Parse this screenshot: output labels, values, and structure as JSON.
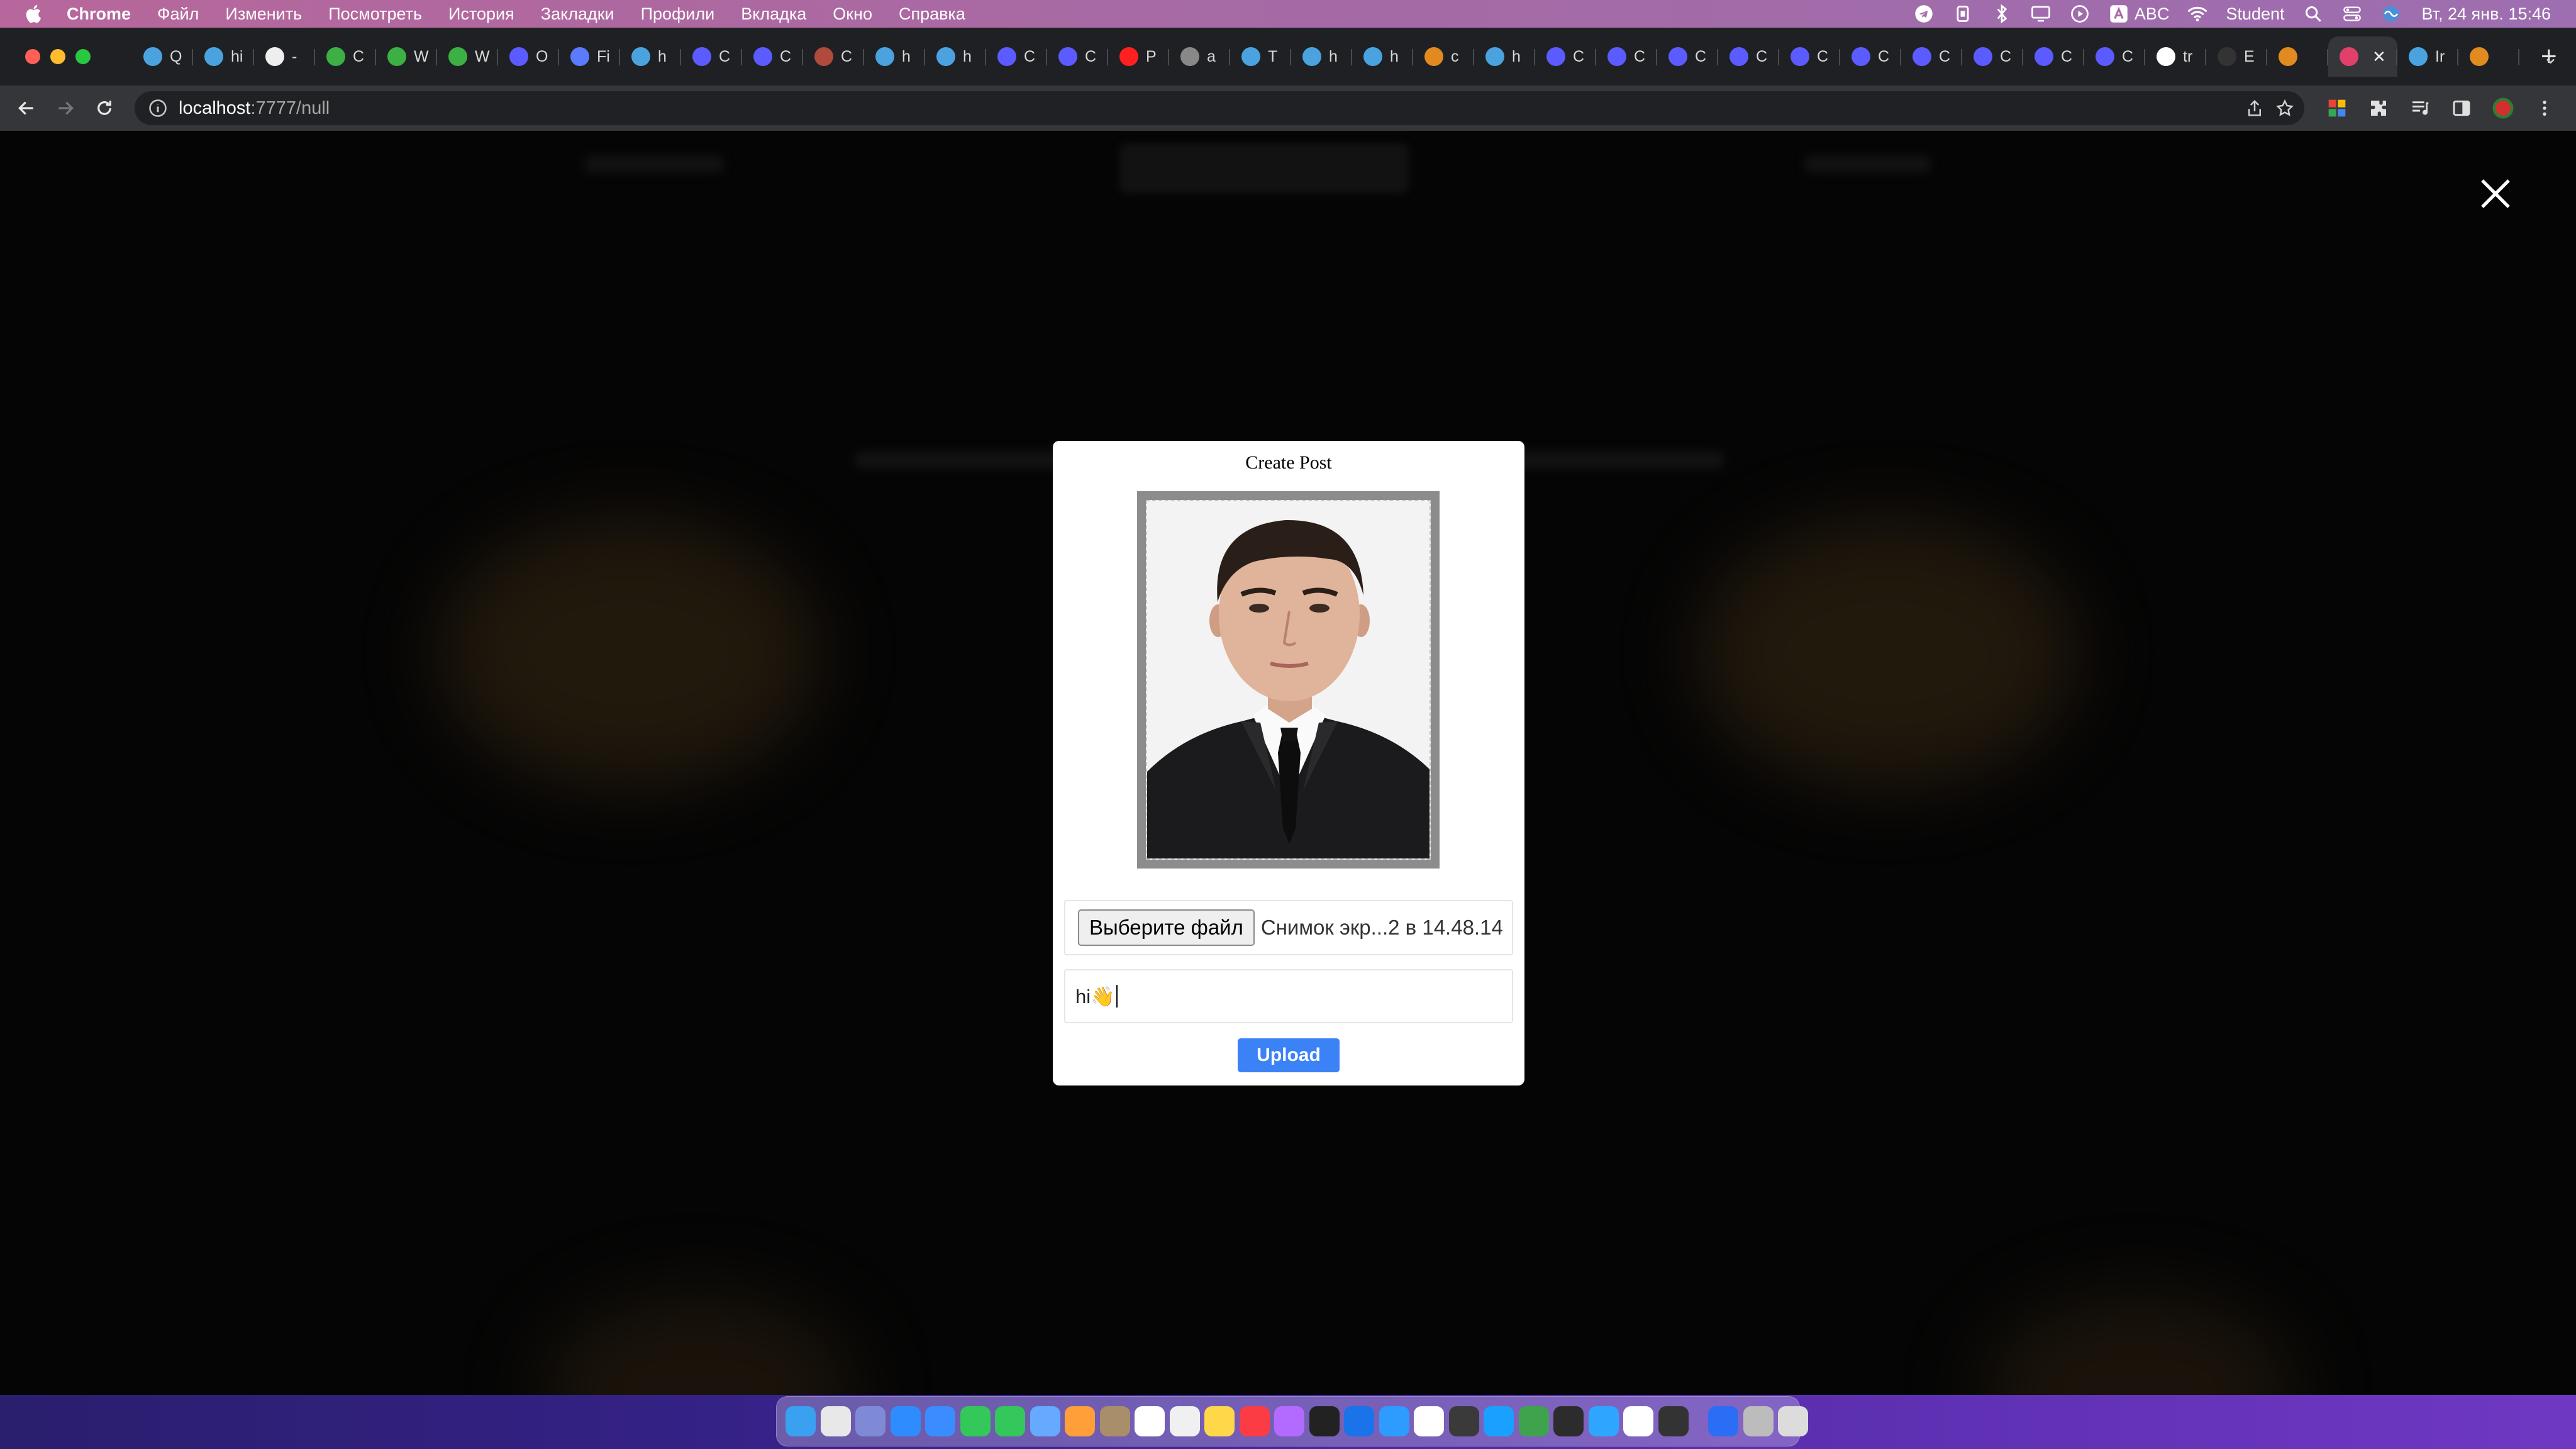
{
  "menubar": {
    "app_name": "Chrome",
    "items": [
      "Файл",
      "Изменить",
      "Посмотреть",
      "История",
      "Закладки",
      "Профили",
      "Вкладка",
      "Окно",
      "Справка"
    ],
    "input_source": "ABC",
    "user": "Student",
    "clock": "Вт, 24 янв.  15:46"
  },
  "tabs": [
    {
      "label": "Q",
      "color": "#4aa3df"
    },
    {
      "label": "hi",
      "color": "#4aa3df"
    },
    {
      "label": "-",
      "color": "#eeeeee"
    },
    {
      "label": "C",
      "color": "#3cb043"
    },
    {
      "label": "W",
      "color": "#3cb043"
    },
    {
      "label": "W",
      "color": "#3cb043"
    },
    {
      "label": "O",
      "color": "#5b5bff"
    },
    {
      "label": "Fi",
      "color": "#5b7bff"
    },
    {
      "label": "h",
      "color": "#4aa3df"
    },
    {
      "label": "C",
      "color": "#5b5bff"
    },
    {
      "label": "C",
      "color": "#5b5bff"
    },
    {
      "label": "C",
      "color": "#b04a3c"
    },
    {
      "label": "h",
      "color": "#4aa3df"
    },
    {
      "label": "h",
      "color": "#4aa3df"
    },
    {
      "label": "C",
      "color": "#5b5bff"
    },
    {
      "label": "C",
      "color": "#5b5bff"
    },
    {
      "label": "P",
      "color": "#ff2020"
    },
    {
      "label": "a",
      "color": "#888888"
    },
    {
      "label": "T",
      "color": "#4aa3df"
    },
    {
      "label": "h",
      "color": "#4aa3df"
    },
    {
      "label": "h",
      "color": "#4aa3df"
    },
    {
      "label": "c",
      "color": "#e08a20"
    },
    {
      "label": "h",
      "color": "#4aa3df"
    },
    {
      "label": "C",
      "color": "#5b5bff"
    },
    {
      "label": "C",
      "color": "#5b5bff"
    },
    {
      "label": "C",
      "color": "#5b5bff"
    },
    {
      "label": "C",
      "color": "#5b5bff"
    },
    {
      "label": "C",
      "color": "#5b5bff"
    },
    {
      "label": "C",
      "color": "#5b5bff"
    },
    {
      "label": "C",
      "color": "#5b5bff"
    },
    {
      "label": "C",
      "color": "#5b5bff"
    },
    {
      "label": "C",
      "color": "#5b5bff"
    },
    {
      "label": "C",
      "color": "#5b5bff"
    },
    {
      "label": "tr",
      "color": "#ffffff"
    },
    {
      "label": "E",
      "color": "#333333"
    },
    {
      "label": "",
      "color": "#e08a20"
    }
  ],
  "active_tab": {
    "label": "",
    "color": "#e0406a"
  },
  "trailing_tabs": [
    {
      "label": "Ir",
      "color": "#4aa3df"
    },
    {
      "label": "",
      "color": "#e08a20"
    }
  ],
  "url": {
    "host": "localhost",
    "path": ":7777/null"
  },
  "modal": {
    "title": "Create Post",
    "file_button": "Выберите файл",
    "file_name": "Снимок экр...2 в 14.48.14",
    "caption_value": "hi👋",
    "upload_label": "Upload"
  },
  "colors": {
    "accent": "#3b82f6",
    "menubar": "#a56aa5",
    "overlay": "#050505"
  },
  "dock_apps": [
    "#3aa0f0",
    "#e8e8e8",
    "#7f8ad6",
    "#2f8cff",
    "#3b8cff",
    "#34c759",
    "#34c759",
    "#66aaff",
    "#ff9f3a",
    "#a88f6a",
    "#ffffff",
    "#f0f0f0",
    "#ffd84a",
    "#fc3c44",
    "#b36bff",
    "#222222",
    "#1a73e8",
    "#2e9bff",
    "#ffffff",
    "#3a3a3a",
    "#1aa0ff",
    "#3fa34d",
    "#2c2c2c",
    "#2ea6ff",
    "#ffffff",
    "#333333",
    "#2b6ef5",
    "#bcbcbc",
    "#dcdcdc"
  ]
}
